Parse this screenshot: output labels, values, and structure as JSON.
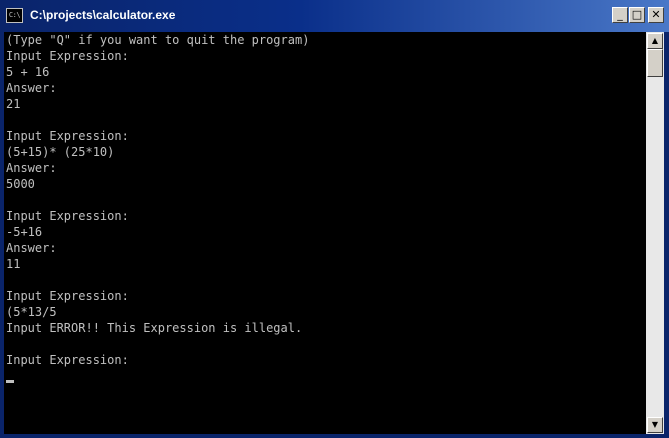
{
  "window": {
    "title": "C:\\projects\\calculator.exe",
    "icon_label": "C:\\"
  },
  "titlebar_buttons": {
    "minimize": "_",
    "maximize": "□",
    "close": "✕"
  },
  "console": {
    "lines": [
      "(Type \"Q\" if you want to quit the program)",
      "Input Expression:",
      "5 + 16",
      "Answer:",
      "21",
      "",
      "Input Expression:",
      "(5+15)* (25*10)",
      "Answer:",
      "5000",
      "",
      "Input Expression:",
      "-5+16",
      "Answer:",
      "11",
      "",
      "Input Expression:",
      "(5*13/5",
      "Input ERROR!! This Expression is illegal.",
      "",
      "Input Expression:"
    ]
  },
  "scrollbar": {
    "up_arrow": "▲",
    "down_arrow": "▼"
  },
  "colors": {
    "titlebar": "#0a246a",
    "console_bg": "#000000",
    "console_text": "#c0c0c0"
  }
}
